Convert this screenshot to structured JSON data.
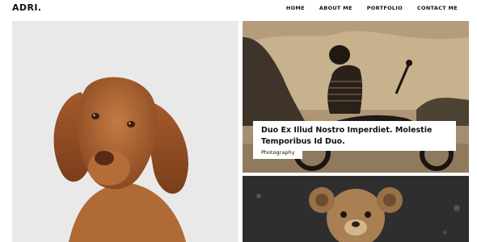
{
  "header": {
    "logo": "ADRI.",
    "nav": [
      "HOME",
      "ABOUT ME",
      "PORTFOLIO",
      "CONTACT ME"
    ]
  },
  "posts": [
    {
      "title": "Duo Ex Illud Nostro Imperdiet. Molestie Temporibus Id Duo.",
      "category": "Photography"
    }
  ],
  "colors": {
    "tile_left_bg": "#e9e9e9",
    "sepia_tone": "#b79e7c",
    "dark_tile": "#2b2b2b"
  }
}
